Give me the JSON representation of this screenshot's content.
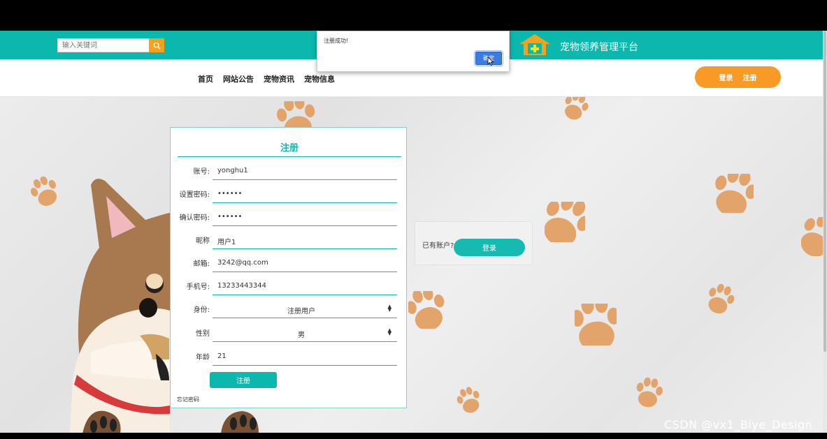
{
  "header": {
    "search_placeholder": "输入关键词",
    "site_title": "宠物领养管理平台",
    "login_label": "登录",
    "register_label": "注册"
  },
  "nav": {
    "items": [
      "首页",
      "网站公告",
      "宠物资讯",
      "宠物信息"
    ]
  },
  "alert": {
    "message": "注册成功!",
    "ok_label": "确定"
  },
  "form": {
    "title": "注册",
    "fields": {
      "account": {
        "label": "账号:",
        "value": "yonghu1"
      },
      "password": {
        "label": "设置密码:",
        "value": "••••••"
      },
      "confirm": {
        "label": "确认密码:",
        "value": "••••••"
      },
      "nickname": {
        "label": "昵称",
        "value": "用户1"
      },
      "email": {
        "label": "邮箱:",
        "value": "3242@qq.com"
      },
      "phone": {
        "label": "手机号:",
        "value": "13233443344"
      },
      "role": {
        "label": "身份:",
        "value": "注册用户"
      },
      "gender": {
        "label": "性别",
        "value": "男"
      },
      "age": {
        "label": "年龄",
        "value": "21"
      }
    },
    "submit_label": "注册",
    "forgot_label": "忘记密码"
  },
  "login_card": {
    "question": "已有账户?",
    "button": "登录"
  },
  "watermark": "CSDN @vx1_Biye_Design",
  "colors": {
    "primary": "#0bb8ae",
    "accent": "#f89a26",
    "paw": "#e2a46a"
  }
}
